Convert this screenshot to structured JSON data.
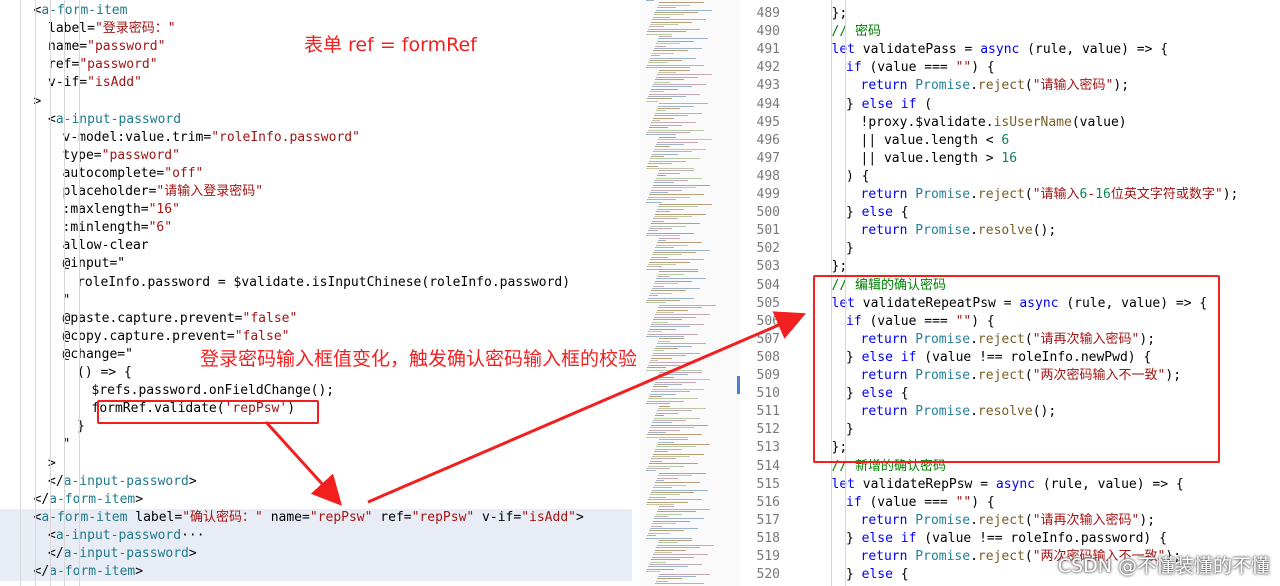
{
  "left_code": {
    "lines": [
      {
        "text": "<a-form-item",
        "indent": 3
      },
      {
        "text": "label=\"登录密码：\"",
        "indent": 4
      },
      {
        "text": "name=\"password\"",
        "indent": 4
      },
      {
        "text": "ref=\"password\"",
        "indent": 4
      },
      {
        "text": "v-if=\"isAdd\"",
        "indent": 4
      },
      {
        "text": ">",
        "indent": 3
      },
      {
        "text": "<a-input-password",
        "indent": 4
      },
      {
        "text": "v-model:value.trim=\"roleInfo.password\"",
        "indent": 5
      },
      {
        "text": "type=\"password\"",
        "indent": 5
      },
      {
        "text": "autocomplete=\"off\"",
        "indent": 5
      },
      {
        "text": "placeholder=\"请输入登录密码\"",
        "indent": 5
      },
      {
        "text": ":maxlength=\"16\"",
        "indent": 5
      },
      {
        "text": ":minlength=\"6\"",
        "indent": 5
      },
      {
        "text": "allow-clear",
        "indent": 5
      },
      {
        "text": "@input=\"",
        "indent": 5
      },
      {
        "text": "roleInfo.password = $validate.isInputChinese(roleInfo.password)",
        "indent": 6
      },
      {
        "text": "\"",
        "indent": 5
      },
      {
        "text": "@paste.capture.prevent=\"false\"",
        "indent": 5
      },
      {
        "text": "@copy.capture.prevent=\"false\"",
        "indent": 5
      },
      {
        "text": "@change=\"",
        "indent": 5
      },
      {
        "text": "() => {",
        "indent": 6
      },
      {
        "text": "$refs.password.onFieldChange();",
        "indent": 7
      },
      {
        "text": "formRef.validate('repPsw')",
        "indent": 7
      },
      {
        "text": "}",
        "indent": 6
      },
      {
        "text": "\"",
        "indent": 5
      },
      {
        "text": ">",
        "indent": 4
      },
      {
        "text": "</a-input-password>",
        "indent": 4
      },
      {
        "text": "</a-form-item>",
        "indent": 3
      },
      {
        "text": "<a-form-item label=\"确认密码：\" name=\"repPsw\" ref=\"repPsw\" v-if=\"isAdd\">",
        "indent": 3
      },
      {
        "text": "<a-input-password···",
        "indent": 4
      },
      {
        "text": "</a-input-password>",
        "indent": 4
      },
      {
        "text": "</a-form-item>",
        "indent": 3
      }
    ]
  },
  "right_code": {
    "lines": [
      {
        "num": "489",
        "text": "};",
        "indent": 1
      },
      {
        "num": "490",
        "text": "// 密码",
        "indent": 1
      },
      {
        "num": "491",
        "text": "let validatePass = async (rule, value) => {",
        "indent": 1
      },
      {
        "num": "492",
        "text": "if (value === \"\") {",
        "indent": 2
      },
      {
        "num": "493",
        "text": "return Promise.reject(\"请输入密码\");",
        "indent": 3
      },
      {
        "num": "494",
        "text": "} else if (",
        "indent": 2
      },
      {
        "num": "495",
        "text": "!proxy.$validate.isUserName(value)",
        "indent": 3
      },
      {
        "num": "496",
        "text": "|| value.length < 6",
        "indent": 3
      },
      {
        "num": "497",
        "text": "|| value.length > 16",
        "indent": 3
      },
      {
        "num": "498",
        "text": ") {",
        "indent": 2
      },
      {
        "num": "499",
        "text": "return Promise.reject(\"请输入6-16位英文字符或数字\");",
        "indent": 3
      },
      {
        "num": "500",
        "text": "} else {",
        "indent": 2
      },
      {
        "num": "501",
        "text": "return Promise.resolve();",
        "indent": 3
      },
      {
        "num": "502",
        "text": "}",
        "indent": 2
      },
      {
        "num": "503",
        "text": "};",
        "indent": 1
      },
      {
        "num": "504",
        "text": "// 编辑的确认密码",
        "indent": 1
      },
      {
        "num": "505",
        "text": "let validateRepeatPsw = async (rule, value) => {",
        "indent": 1
      },
      {
        "num": "506",
        "text": "if (value === \"\") {",
        "indent": 2
      },
      {
        "num": "507",
        "text": "return Promise.reject(\"请再次输入密码\");",
        "indent": 3
      },
      {
        "num": "508",
        "text": "} else if (value !== roleInfo.newPwd) {",
        "indent": 2
      },
      {
        "num": "509",
        "text": "return Promise.reject(\"两次密码输入不一致\");",
        "indent": 3
      },
      {
        "num": "510",
        "text": "} else {",
        "indent": 2
      },
      {
        "num": "511",
        "text": "return Promise.resolve();",
        "indent": 3
      },
      {
        "num": "512",
        "text": "}",
        "indent": 2
      },
      {
        "num": "513",
        "text": "};",
        "indent": 1
      },
      {
        "num": "514",
        "text": "// 新增的确认密码",
        "indent": 1
      },
      {
        "num": "515",
        "text": "let validateRepPsw = async (rule, value) => {",
        "indent": 1
      },
      {
        "num": "516",
        "text": "if (value === \"\") {",
        "indent": 2
      },
      {
        "num": "517",
        "text": "return Promise.reject(\"请再次输入密码\");",
        "indent": 3
      },
      {
        "num": "518",
        "text": "} else if (value !== roleInfo.password) {",
        "indent": 2
      },
      {
        "num": "519",
        "text": "return Promise.reject(\"两次密码输入不一致\");",
        "indent": 3
      },
      {
        "num": "520",
        "text": "} else {",
        "indent": 2
      }
    ]
  },
  "annotations": {
    "form_ref_note": "表单 ref = formRef",
    "change_note": "登录密码输入框值变化，触发确认密码输入框的校验"
  },
  "watermark": "CSDN @不懂装懂的不懂",
  "colors": {
    "annotation_red": "#f31f1f",
    "highlight_line": "#e8ecf4"
  }
}
